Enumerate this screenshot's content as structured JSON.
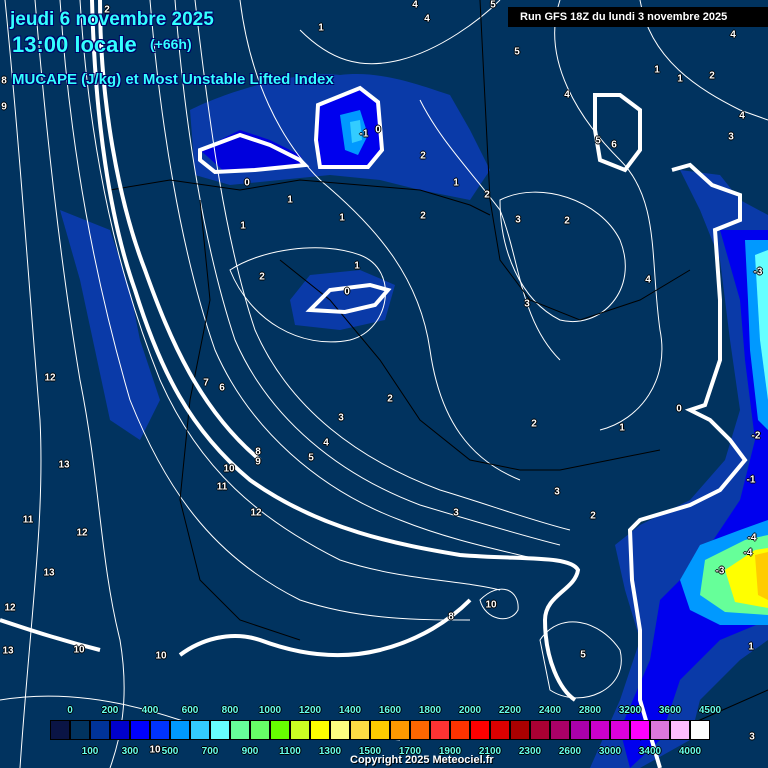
{
  "header": {
    "date": "jeudi 6 novembre 2025",
    "time": "13:00 locale",
    "lead": "(+66h)",
    "title": "MUCAPE (J/kg) et Most Unstable Lifted Index",
    "run": "Run GFS 18Z du lundi 3 novembre 2025"
  },
  "map": {
    "background_color": "#01335f",
    "contour_labels": [
      "2",
      "4",
      "4",
      "5",
      "1",
      "5",
      "1",
      "1",
      "2",
      "4",
      "4",
      "4",
      "3",
      "5",
      "6",
      "-1",
      "0",
      "2",
      "1",
      "2",
      "0",
      "1",
      "1",
      "1",
      "2",
      "3",
      "2",
      "1",
      "2",
      "0",
      "4",
      "3",
      "-3",
      "12",
      "7",
      "6",
      "2",
      "3",
      "0",
      "2",
      "1",
      "-2",
      "4",
      "8",
      "9",
      "5",
      "10",
      "13",
      "-1",
      "11",
      "3",
      "12",
      "3",
      "2",
      "11",
      "12",
      "-4",
      "-4",
      "13",
      "-3",
      "12",
      "10",
      "8",
      "13",
      "10",
      "10",
      "5",
      "1",
      "3",
      "8",
      "9",
      "10"
    ]
  },
  "colorbar": {
    "colors": [
      "#0a1445",
      "#01335f",
      "#003399",
      "#0000cc",
      "#0000ff",
      "#0033ff",
      "#0099ff",
      "#33ccff",
      "#66ffff",
      "#66ff99",
      "#66ff66",
      "#66ff00",
      "#ccff22",
      "#ffff00",
      "#ffff80",
      "#ffdd44",
      "#ffcc00",
      "#ff9900",
      "#ff6600",
      "#ff3333",
      "#ff3300",
      "#ff0000",
      "#dd0000",
      "#aa0000",
      "#aa0033",
      "#aa0066",
      "#aa00aa",
      "#cc00cc",
      "#dd00dd",
      "#ff00ff",
      "#dd77dd",
      "#ffbbff",
      "#ffffff"
    ],
    "labels": [
      "0",
      "100",
      "200",
      "300",
      "400",
      "500",
      "600",
      "700",
      "800",
      "900",
      "1000",
      "1100",
      "1200",
      "1300",
      "1400",
      "1500",
      "1600",
      "1700",
      "1800",
      "1900",
      "2000",
      "2100",
      "2200",
      "2300",
      "2400",
      "2600",
      "2800",
      "3000",
      "3200",
      "3400",
      "3600",
      "4000",
      "4500"
    ]
  },
  "footer": {
    "copyright": "Copyright 2025 Meteociel.fr"
  }
}
